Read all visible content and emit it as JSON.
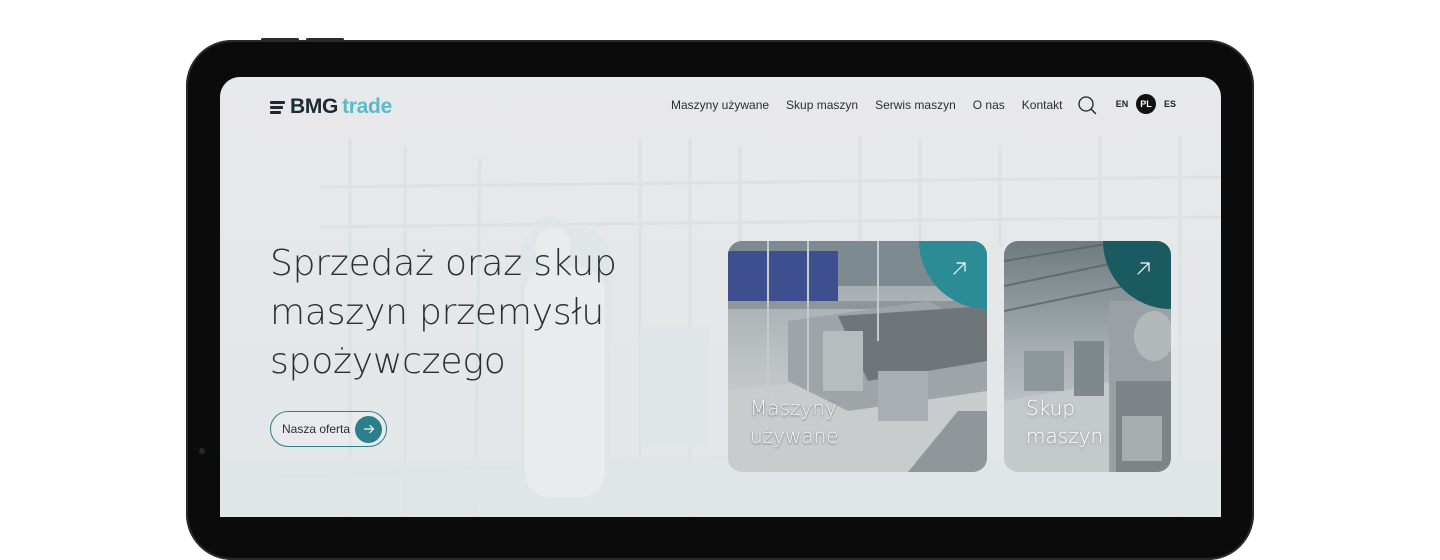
{
  "header": {
    "logo_bmg": "BMG",
    "logo_trade": "trade",
    "nav": [
      {
        "label": "Maszyny używane"
      },
      {
        "label": "Skup maszyn"
      },
      {
        "label": "Serwis maszyn"
      },
      {
        "label": "O nas"
      },
      {
        "label": "Kontakt"
      }
    ],
    "languages": [
      {
        "code": "EN",
        "active": false
      },
      {
        "code": "PL",
        "active": true
      },
      {
        "code": "ES",
        "active": false
      }
    ]
  },
  "hero": {
    "title_lines": [
      "Sprzedaż oraz skup",
      "maszyn przemysłu",
      "spożywczego"
    ],
    "cta_label": "Nasza oferta"
  },
  "cards": [
    {
      "label_lines": [
        "Maszyny",
        "używane"
      ],
      "icon": "arrow-up-right-icon",
      "accent": "#2b8c96"
    },
    {
      "label_lines": [
        "Skup",
        "maszyn"
      ],
      "icon": "arrow-up-right-icon",
      "accent": "#1a5a61"
    }
  ],
  "colors": {
    "brand_dark": "#1c2b33",
    "brand_teal": "#5bbac6",
    "cta_teal": "#2a7f8a"
  }
}
